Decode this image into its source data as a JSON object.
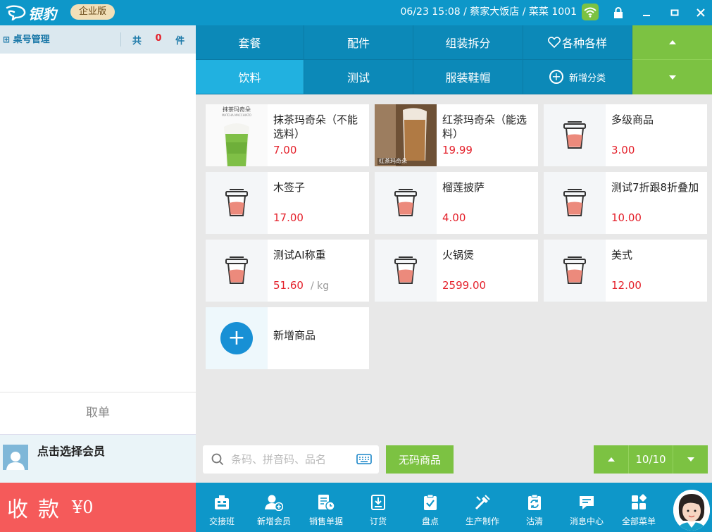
{
  "app": {
    "logo_text": "银豹",
    "edition": "企业版"
  },
  "status": {
    "datetime": "06/23 15:08",
    "store": "蔡家大饭店",
    "user": "菜菜 1001",
    "separator": "/"
  },
  "order_panel": {
    "title": "桌号管理",
    "count_prefix": "共",
    "count": "0",
    "count_suffix": "件",
    "cancel_label": "取单",
    "member_label": "点击选择会员"
  },
  "checkout": {
    "label": "收款",
    "amount": "¥0"
  },
  "categories": [
    {
      "label": "套餐"
    },
    {
      "label": "配件"
    },
    {
      "label": "组装拆分"
    },
    {
      "label": "各种各样"
    },
    {
      "label": "饮料"
    },
    {
      "label": "测试"
    },
    {
      "label": "服装鞋帽"
    },
    {
      "label": "新增分类"
    }
  ],
  "products": [
    {
      "name": "抹茶玛奇朵（不能选料）",
      "price": "7.00"
    },
    {
      "name": "红茶玛奇朵（能选料）",
      "price": "19.99"
    },
    {
      "name": "多级商品",
      "price": "3.00"
    },
    {
      "name": "木签子",
      "price": "17.00"
    },
    {
      "name": "榴莲披萨",
      "price": "4.00"
    },
    {
      "name": "测试7折跟8折叠加",
      "price": "10.00"
    },
    {
      "name": "测试AI称重",
      "price": "51.60",
      "unit": "/ kg"
    },
    {
      "name": "火锅煲",
      "price": "2599.00"
    },
    {
      "name": "美式",
      "price": "12.00"
    },
    {
      "name": "新增商品"
    }
  ],
  "thumb_text": {
    "matcha_top": "抹茶玛奇朵",
    "matcha_sub": "MATCHA MACCHIATO",
    "black_tea": "红茶玛奇朵"
  },
  "search": {
    "placeholder": "条码、拼音码、品名"
  },
  "nocode_label": "无码商品",
  "pager": {
    "page": "10/10"
  },
  "toolbar": [
    {
      "label": "交接班",
      "icon": "handover-icon"
    },
    {
      "label": "新增会员",
      "icon": "add-member-icon"
    },
    {
      "label": "销售单据",
      "icon": "sales-doc-icon"
    },
    {
      "label": "订货",
      "icon": "order-goods-icon"
    },
    {
      "label": "盘点",
      "icon": "inventory-icon"
    },
    {
      "label": "生产制作",
      "icon": "production-icon"
    },
    {
      "label": "沽清",
      "icon": "soldout-icon"
    },
    {
      "label": "消息中心",
      "icon": "message-icon"
    },
    {
      "label": "全部菜单",
      "icon": "all-menu-icon"
    }
  ],
  "colors": {
    "primary": "#0e97c9",
    "category": "#0c89b8",
    "category_active": "#21b1e0",
    "green": "#7cc242",
    "checkout": "#f55a5a",
    "price": "#e4212b"
  }
}
